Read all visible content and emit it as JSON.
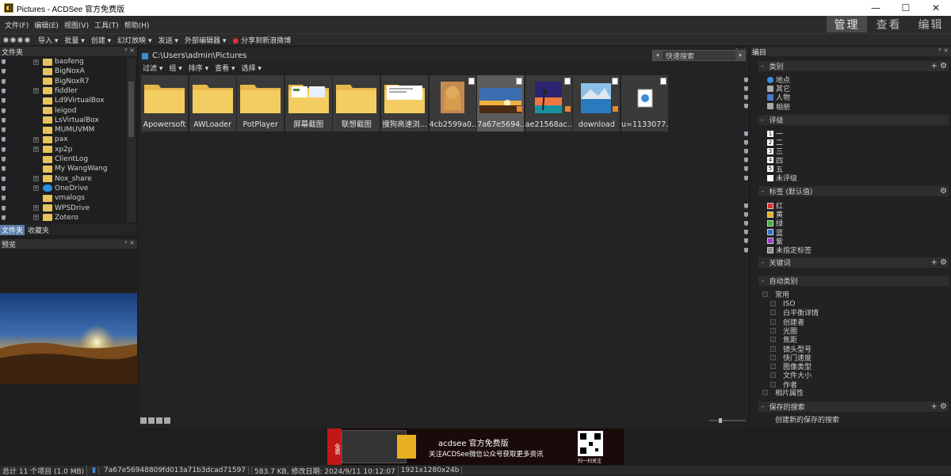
{
  "window": {
    "title": "Pictures - ACDSee 官方免费版",
    "app_icon": "acdsee-logo-icon"
  },
  "menu": [
    "文件(F)",
    "编辑(E)",
    "视图(V)",
    "工具(T)",
    "帮助(H)"
  ],
  "modes": [
    {
      "label": "管理",
      "active": true
    },
    {
      "label": "查看",
      "active": false
    },
    {
      "label": "编辑",
      "active": false
    }
  ],
  "toolbar": [
    "导入 ▾",
    "批量 ▾",
    "创建 ▾",
    "幻灯放映 ▾",
    "发送 ▾",
    "外部编辑器 ▾",
    "分享到新浪微博"
  ],
  "folders_panel": {
    "title": "文件夹",
    "items": [
      {
        "label": "baofeng",
        "expandable": true
      },
      {
        "label": "BigNoxA",
        "expandable": false
      },
      {
        "label": "BigNoxR7",
        "expandable": false
      },
      {
        "label": "fiddler",
        "expandable": true
      },
      {
        "label": "Ld9VirtualBox",
        "expandable": false
      },
      {
        "label": "leigod",
        "expandable": false
      },
      {
        "label": "LsVirtualBox",
        "expandable": false
      },
      {
        "label": "MUMUVMM",
        "expandable": false
      },
      {
        "label": "pax",
        "expandable": true
      },
      {
        "label": "xp2p",
        "expandable": true
      },
      {
        "label": "ClientLog",
        "expandable": false
      },
      {
        "label": "My WangWang",
        "expandable": false
      },
      {
        "label": "Nox_share",
        "expandable": true
      },
      {
        "label": "OneDrive",
        "expandable": true,
        "cloud": true
      },
      {
        "label": "vmalogs",
        "expandable": false
      },
      {
        "label": "WPSDrive",
        "expandable": true
      },
      {
        "label": "Zotero",
        "expandable": true
      }
    ],
    "tabs": [
      {
        "label": "文件夹",
        "active": true
      },
      {
        "label": "收藏夹",
        "active": false
      }
    ]
  },
  "preview_panel": {
    "title": "预览"
  },
  "browser": {
    "path": "C:\\Users\\admin\\Pictures",
    "quick_search_placeholder": "快速搜索",
    "filters": [
      "过滤 ▾",
      "组 ▾",
      "排序 ▾",
      "查看 ▾",
      "选择 ▾"
    ],
    "items": [
      {
        "label": "Apowersoft",
        "kind": "folder"
      },
      {
        "label": "AWLoader",
        "kind": "folder"
      },
      {
        "label": "PotPlayer",
        "kind": "folder"
      },
      {
        "label": "屏幕截图",
        "kind": "folder-screens"
      },
      {
        "label": "联想截图",
        "kind": "folder"
      },
      {
        "label": "搜狗高速浏...",
        "kind": "folder-doc"
      },
      {
        "label": "4cb2599a0...",
        "kind": "portrait"
      },
      {
        "label": "7a67e5694...",
        "kind": "sunset",
        "selected": true
      },
      {
        "label": "ae21568ac...",
        "kind": "beach"
      },
      {
        "label": "download",
        "kind": "lake"
      },
      {
        "label": "u=1133077...",
        "kind": "file"
      }
    ]
  },
  "edit_panel": {
    "title": "编目",
    "sections": {
      "category": {
        "title": "类别",
        "items": [
          "地点",
          "其它",
          "人物",
          "相册"
        ]
      },
      "rating": {
        "title": "评级",
        "items": [
          {
            "n": "1",
            "label": "一"
          },
          {
            "n": "2",
            "label": "二"
          },
          {
            "n": "3",
            "label": "三"
          },
          {
            "n": "4",
            "label": "四"
          },
          {
            "n": "5",
            "label": "五"
          },
          {
            "n": "",
            "label": "未评级"
          }
        ]
      },
      "labels": {
        "title": "标签 (默认值)",
        "items": [
          {
            "label": "红",
            "color": "#e03030"
          },
          {
            "label": "黄",
            "color": "#e8b020"
          },
          {
            "label": "绿",
            "color": "#40b040"
          },
          {
            "label": "蓝",
            "color": "#3070d0"
          },
          {
            "label": "紫",
            "color": "#a040c0"
          },
          {
            "label": "未指定标签",
            "color": "#888888"
          }
        ]
      },
      "keywords": {
        "title": "关键词"
      },
      "auto": {
        "title": "自动类别",
        "group": "常用",
        "items": [
          "ISO",
          "白平衡详情",
          "创建者",
          "光圈",
          "焦距",
          "镜头型号",
          "快门速度",
          "图像类型",
          "文件大小",
          "作者"
        ],
        "extra": "相片属性"
      },
      "saved": {
        "title": "保存的搜索",
        "create": "创建新的保存的搜索"
      }
    }
  },
  "status": {
    "total": "总计 11 个项目 (1.0 MB)",
    "file": "7a67e56948809fd013a71b3dcad71597",
    "info": "583.7 KB, 修改日期: 2024/9/11 10:12:07",
    "dims": "1921x1280x24b"
  },
  "ad": {
    "brand": "acdsee 官方免费版",
    "line": "关注ACDSee微信公众号获取更多资讯",
    "scan": "扫一扫关注",
    "tag": "免费"
  }
}
